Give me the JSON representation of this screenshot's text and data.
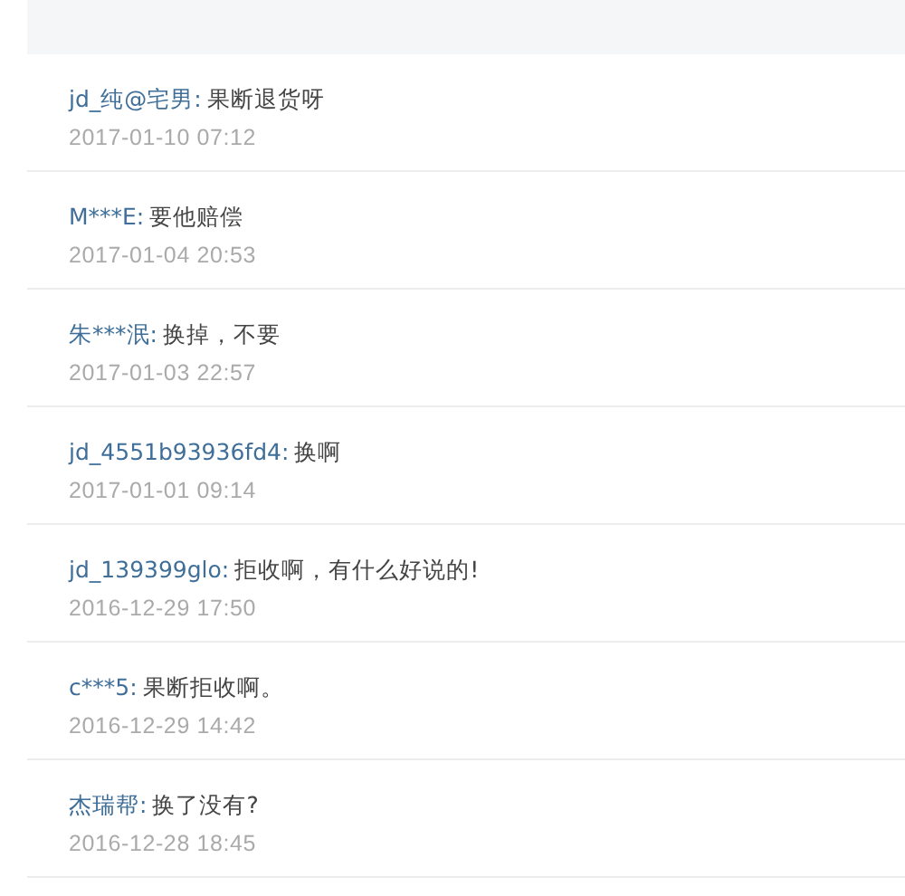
{
  "comments": [
    {
      "name": "jd_纯@宅男:",
      "text": "果断退货呀",
      "time": "2017-01-10 07:12"
    },
    {
      "name": "M***E:",
      "text": "要他赔偿",
      "time": "2017-01-04 20:53"
    },
    {
      "name": "朱***泯:",
      "text": "换掉，不要",
      "time": "2017-01-03 22:57"
    },
    {
      "name": "jd_4551b93936fd4:",
      "text": "换啊",
      "time": "2017-01-01 09:14"
    },
    {
      "name": "jd_139399glo:",
      "text": "拒收啊，有什么好说的!",
      "time": "2016-12-29 17:50"
    },
    {
      "name": "c***5:",
      "text": "果断拒收啊。",
      "time": "2016-12-29 14:42"
    },
    {
      "name": "杰瑞帮:",
      "text": "换了没有?",
      "time": "2016-12-28 18:45"
    }
  ]
}
